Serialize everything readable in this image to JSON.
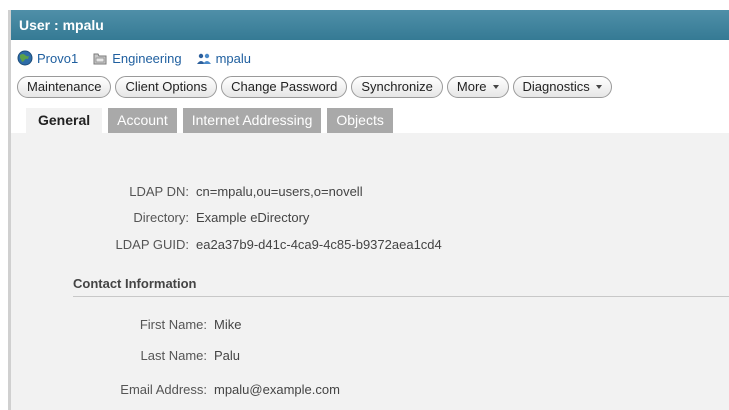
{
  "window": {
    "title": "User : mpalu"
  },
  "breadcrumb": [
    {
      "label": "Provo1",
      "icon": "globe-icon"
    },
    {
      "label": "Engineering",
      "icon": "folder-icon"
    },
    {
      "label": "mpalu",
      "icon": "user-icon"
    }
  ],
  "actions": [
    {
      "label": "Maintenance",
      "dropdown": false
    },
    {
      "label": "Client Options",
      "dropdown": false
    },
    {
      "label": "Change Password",
      "dropdown": false
    },
    {
      "label": "Synchronize",
      "dropdown": false
    },
    {
      "label": "More",
      "dropdown": true
    },
    {
      "label": "Diagnostics",
      "dropdown": true
    }
  ],
  "tabs": [
    {
      "label": "General",
      "active": true
    },
    {
      "label": "Account",
      "active": false
    },
    {
      "label": "Internet Addressing",
      "active": false
    },
    {
      "label": "Objects",
      "active": false
    }
  ],
  "details": {
    "ldap_dn": {
      "label": "LDAP DN:",
      "value": "cn=mpalu,ou=users,o=novell"
    },
    "directory": {
      "label": "Directory:",
      "value": "Example eDirectory"
    },
    "ldap_guid": {
      "label": "LDAP GUID:",
      "value": "ea2a37b9-d41c-4ca9-4c85-b9372aea1cd4"
    }
  },
  "contact": {
    "section_title": "Contact Information",
    "first_name": {
      "label": "First Name:",
      "value": "Mike"
    },
    "last_name": {
      "label": "Last Name:",
      "value": "Palu"
    },
    "email": {
      "label": "Email Address:",
      "value": "mpalu@example.com"
    }
  },
  "colors": {
    "titlebar": "#357a94",
    "link": "#1f5f9f",
    "tab_inactive": "#a9a9a9",
    "panel": "#f2f2f2"
  }
}
